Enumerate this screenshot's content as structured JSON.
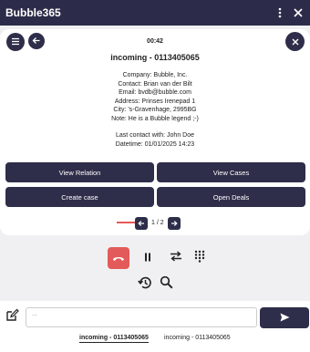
{
  "app": {
    "title": "Bubble365"
  },
  "call": {
    "timer": "00:42",
    "title": "incoming - 0113405065",
    "info_lines": [
      "Company: Bubble, Inc.",
      "Contact: Brian van der Bilt",
      "Email: bvdb@bubble.com",
      "Address: Prinses Irenepad 1",
      "City: 's-Gravenhage, 2995BG",
      "Note: He is a Bubble legend ;-)"
    ],
    "last_contact_lines": [
      "Last contact with: John Doe",
      "Datetime: 01/01/2025 14:23"
    ]
  },
  "actions": {
    "view_relation": "View Relation",
    "view_cases": "View Cases",
    "create_case": "Create case",
    "open_deals": "Open Deals"
  },
  "pager": {
    "label": "1 / 2"
  },
  "message": {
    "placeholder": "..."
  },
  "tabs": [
    {
      "label": "incoming - 0113405065",
      "active": true
    },
    {
      "label": "incoming - 0113405065",
      "active": false
    }
  ],
  "colors": {
    "header": "#2c2c4a",
    "button": "#2e2e4a",
    "hangup": "#e35a5a",
    "annotation_arrow": "#e02020"
  },
  "icons": [
    "dots-vertical-icon",
    "close-icon",
    "menu-icon",
    "back-arrow-icon",
    "hangup-icon",
    "pause-icon",
    "transfer-icon",
    "dialpad-icon",
    "history-icon",
    "search-icon",
    "edit-icon",
    "send-icon"
  ]
}
